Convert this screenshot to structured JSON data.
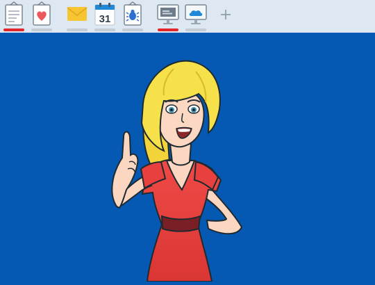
{
  "toolbar": {
    "tabs": [
      {
        "name": "notes-tab",
        "icon": "clipboard-notes-icon",
        "active": true
      },
      {
        "name": "health-tab",
        "icon": "clipboard-heart-icon",
        "active": false
      },
      {
        "name": "mail-tab",
        "icon": "mail-icon",
        "active": false
      },
      {
        "name": "calendar-tab",
        "icon": "calendar-icon",
        "active": false,
        "label": "31"
      },
      {
        "name": "bug-report-tab",
        "icon": "clipboard-bug-icon",
        "active": false
      },
      {
        "name": "desktop-tab",
        "icon": "monitor-screen-icon",
        "active": true
      },
      {
        "name": "cloud-desktop-tab",
        "icon": "monitor-cloud-icon",
        "active": false
      }
    ],
    "add_icon": "plus-icon"
  },
  "stage": {
    "background": "#0659b3",
    "illustration": "cartoon-woman-pointing-up"
  },
  "colors": {
    "toolbar_bg": "#dde8f2",
    "active_indicator": "#e4262c",
    "inactive_indicator": "#c4cdd6",
    "dress": "#e8403e",
    "hair": "#f7e14a"
  }
}
